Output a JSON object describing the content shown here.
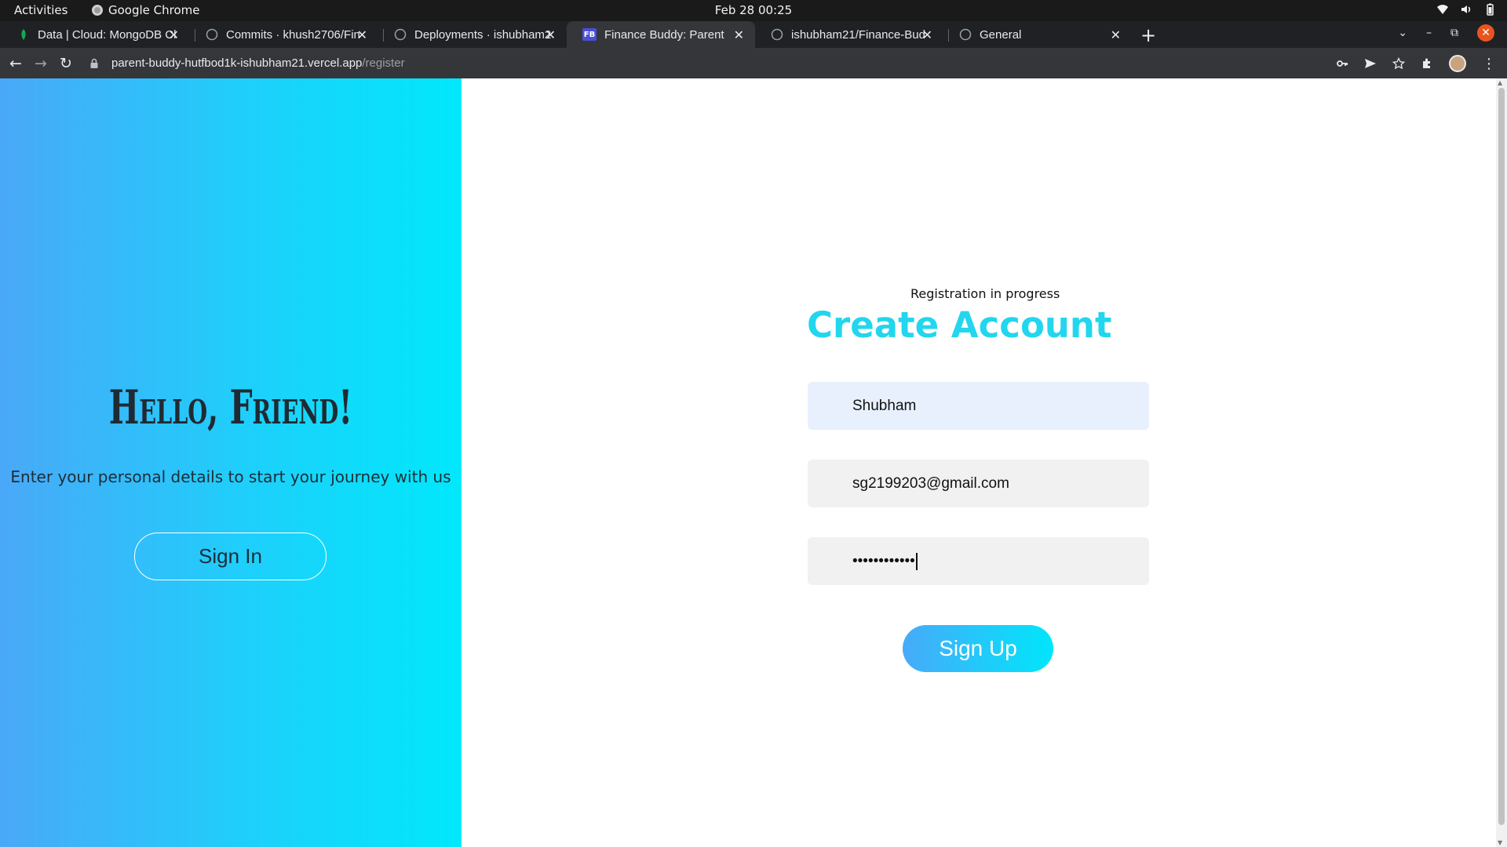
{
  "system_bar": {
    "activities": "Activities",
    "app_name": "Google Chrome",
    "clock": "Feb 28  00:25"
  },
  "tabs": [
    {
      "title": "Data | Cloud: MongoDB Cl",
      "icon": "mongodb-leaf-icon",
      "active": false
    },
    {
      "title": "Commits · khush2706/Fin",
      "icon": "github-icon",
      "active": false
    },
    {
      "title": "Deployments · ishubham2",
      "icon": "github-icon",
      "active": false
    },
    {
      "title": "Finance Buddy: Parent",
      "icon": "fb-favicon",
      "active": true
    },
    {
      "title": "ishubham21/Finance-Bud",
      "icon": "github-icon",
      "active": false
    },
    {
      "title": "General",
      "icon": "github-icon",
      "active": false
    }
  ],
  "favicon_text": "FB",
  "url": {
    "host": "parent-buddy-hutfbod1k-ishubham21.vercel.app",
    "path": "/register"
  },
  "left_panel": {
    "heading": "Hello, Friend!",
    "subtitle": "Enter your personal details to start your journey with us",
    "signin_label": "Sign In"
  },
  "form": {
    "status": "Registration in progress",
    "title": "Create Account",
    "name_value": "Shubham",
    "email_value": "sg2199203@gmail.com",
    "password_masked": "••••••••••••",
    "signup_label": "Sign Up"
  },
  "colors": {
    "accent": "#22d6ee",
    "gradient_start": "#4aa8f8",
    "gradient_end": "#00e8fb"
  }
}
